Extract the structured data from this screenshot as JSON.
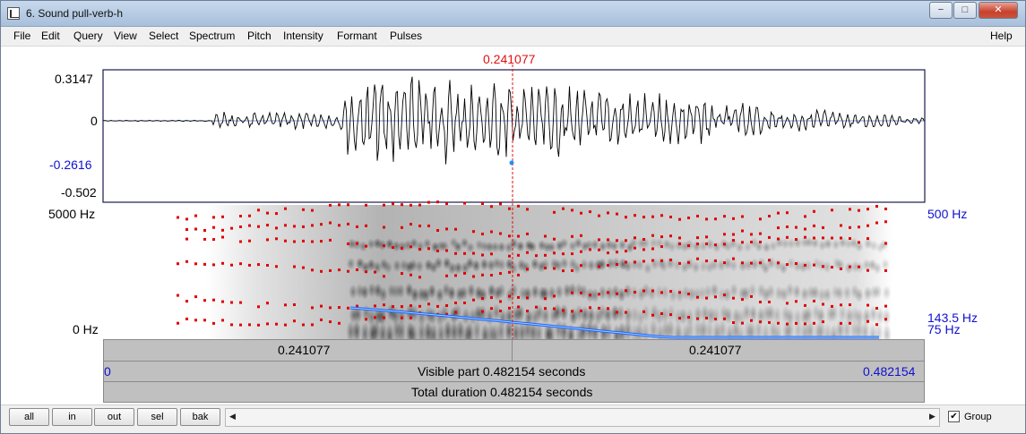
{
  "window": {
    "title": "6. Sound pull-verb-h",
    "minimize_glyph": "−",
    "maximize_glyph": "□",
    "close_glyph": "✕"
  },
  "menu": {
    "items": [
      "File",
      "Edit",
      "Query",
      "View",
      "Select",
      "Spectrum",
      "Pitch",
      "Intensity",
      "Formant",
      "Pulses"
    ],
    "help": "Help"
  },
  "cursor": {
    "time_label": "0.241077",
    "time_s": 0.241077
  },
  "waveform": {
    "y_max": "0.3147",
    "y_zero": "0",
    "y_cursor_value": "-0.2616",
    "y_min": "-0.502"
  },
  "spectrogram": {
    "freq_top": "5000 Hz",
    "freq_bottom": "0 Hz",
    "pitch_top": "500 Hz",
    "pitch_cursor": "143.5 Hz",
    "pitch_bottom": "75 Hz"
  },
  "time_bars": {
    "left_segment": "0.241077",
    "right_segment": "0.241077",
    "visible_start": "0",
    "visible_label": "Visible part 0.482154 seconds",
    "visible_end": "0.482154",
    "total_label": "Total duration 0.482154 seconds"
  },
  "bottom": {
    "buttons": [
      "all",
      "in",
      "out",
      "sel",
      "bak"
    ],
    "scroll_left": "◀",
    "scroll_right": "▶",
    "group_label": "Group",
    "group_checked": true,
    "check_glyph": "✔"
  },
  "colors": {
    "cursor": "#e01010",
    "axis_blue": "#1010d0",
    "formant_dots": "#e00000",
    "pitch_line": "#1e64ff"
  }
}
